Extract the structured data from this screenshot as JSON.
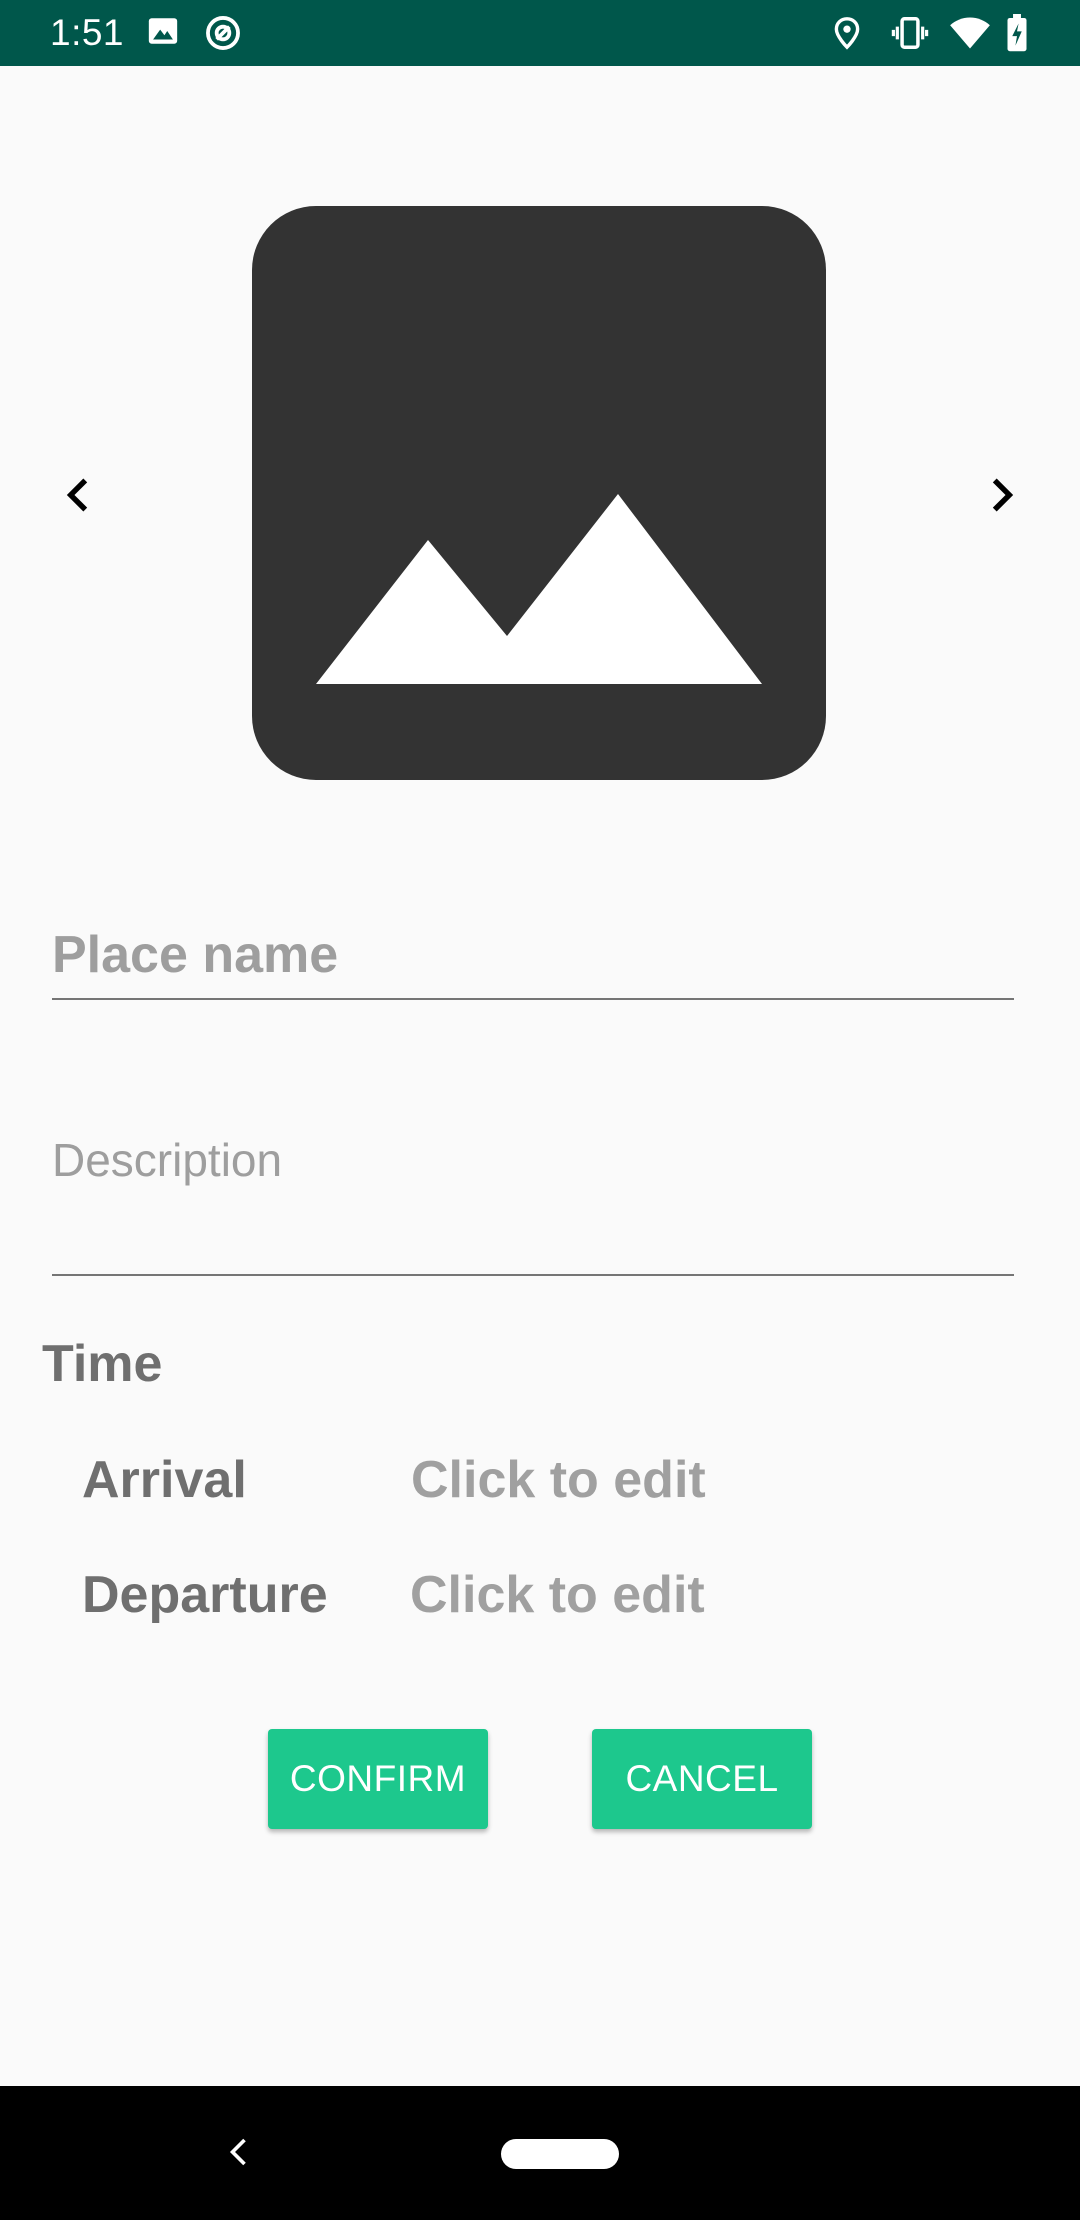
{
  "status_bar": {
    "time": "1:51",
    "left_icons": [
      "image-icon",
      "at-sign-icon"
    ],
    "right_icons": [
      "location-icon",
      "vibrate-icon",
      "wifi-icon",
      "battery-charging-icon"
    ],
    "background": "#00574b"
  },
  "carousel": {
    "image_icon": "image-placeholder-icon",
    "prev_icon": "chevron-left-icon",
    "next_icon": "chevron-right-icon"
  },
  "form": {
    "place_name_placeholder": "Place name",
    "place_name_value": "",
    "description_placeholder": "Description",
    "description_value": ""
  },
  "time_section": {
    "title": "Time",
    "arrival_label": "Arrival",
    "arrival_value": "Click to edit",
    "departure_label": "Departure",
    "departure_value": "Click to edit"
  },
  "actions": {
    "confirm_label": "CONFIRM",
    "cancel_label": "CANCEL",
    "accent": "#1dc88d"
  },
  "nav_bar": {
    "back_icon": "back-icon",
    "home_icon": "home-pill-icon"
  }
}
